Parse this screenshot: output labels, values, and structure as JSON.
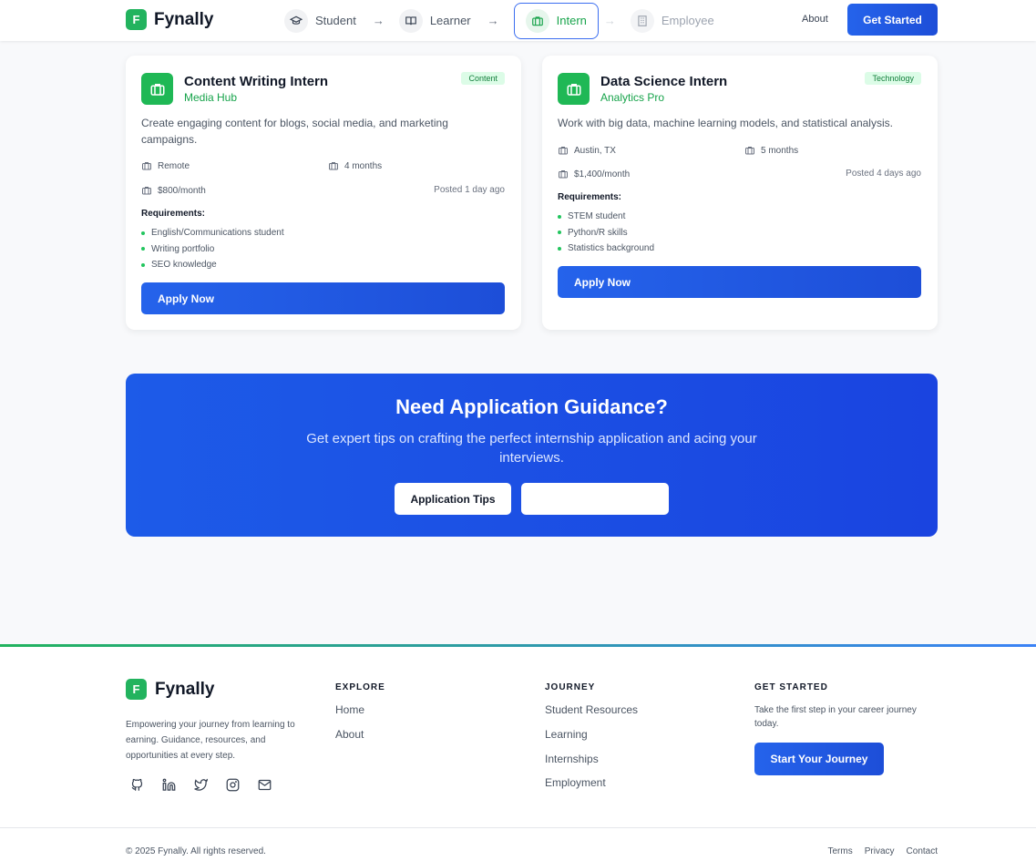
{
  "header": {
    "logo_letter": "F",
    "brand": "Fynally",
    "journey": [
      {
        "label": "Student",
        "icon": "graduation-cap-icon",
        "state": "default"
      },
      {
        "label": "Learner",
        "icon": "book-icon",
        "state": "default"
      },
      {
        "label": "Intern",
        "icon": "briefcase-icon",
        "state": "active"
      },
      {
        "label": "Employee",
        "icon": "building-icon",
        "state": "disabled"
      }
    ],
    "about": "About",
    "cta": "Get Started"
  },
  "cards": [
    {
      "title": "Content Writing Intern",
      "company": "Media Hub",
      "tag": "Content",
      "description": "Create engaging content for blogs, social media, and marketing campaigns.",
      "location": "Remote",
      "duration": "4 months",
      "stipend": "$800/month",
      "posted": "Posted 1 day ago",
      "requirements_title": "Requirements:",
      "requirements": [
        "English/Communications student",
        "Writing portfolio",
        "SEO knowledge"
      ],
      "apply": "Apply Now"
    },
    {
      "title": "Data Science Intern",
      "company": "Analytics Pro",
      "tag": "Technology",
      "description": "Work with big data, machine learning models, and statistical analysis.",
      "location": "Austin, TX",
      "duration": "5 months",
      "stipend": "$1,400/month",
      "posted": "Posted 4 days ago",
      "requirements_title": "Requirements:",
      "requirements": [
        "STEM student",
        "Python/R skills",
        "Statistics background"
      ],
      "apply": "Apply Now"
    }
  ],
  "cta": {
    "title": "Need Application Guidance?",
    "subtitle": "Get expert tips on crafting the perfect internship application and acing your interviews.",
    "primary": "Application Tips",
    "secondary": ""
  },
  "footer": {
    "brand": "Fynally",
    "logo_letter": "F",
    "tagline": "Empowering your journey from learning to earning. Guidance, resources, and opportunities at every step.",
    "socials": [
      "github-icon",
      "linkedin-icon",
      "twitter-icon",
      "instagram-icon",
      "mail-icon"
    ],
    "explore": {
      "title": "EXPLORE",
      "links": [
        "Home",
        "About"
      ]
    },
    "journey": {
      "title": "JOURNEY",
      "links": [
        "Student Resources",
        "Learning",
        "Internships",
        "Employment"
      ]
    },
    "get_started": {
      "title": "GET STARTED",
      "text": "Take the first step in your career journey today.",
      "button": "Start Your Journey"
    },
    "copyright": "© 2025 Fynally. All rights reserved.",
    "legal": [
      "Terms",
      "Privacy",
      "Contact"
    ]
  },
  "colors": {
    "brand_green": "#22b35e",
    "primary_blue": "#2563eb",
    "cta_blue": "#1d4ed8"
  }
}
